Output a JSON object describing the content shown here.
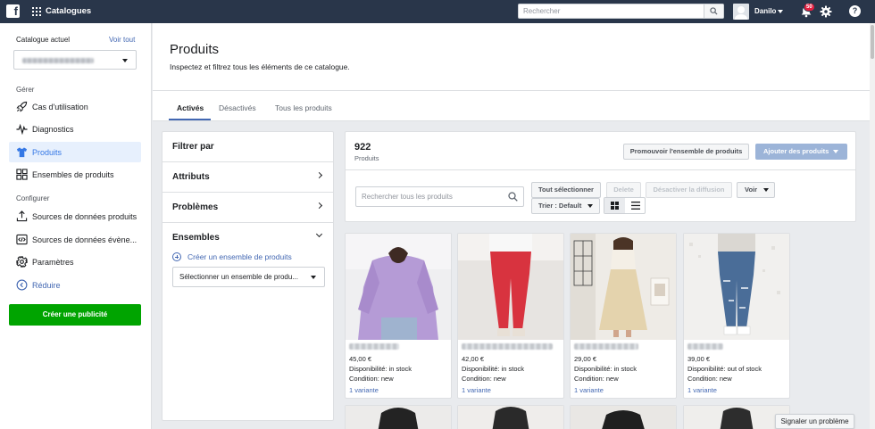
{
  "topbar": {
    "logo": "f",
    "app_name": "Catalogues",
    "search_placeholder": "Rechercher",
    "user_name": "Danilo",
    "notification_count": "50",
    "help": "?"
  },
  "sidebar": {
    "catalog_label": "Catalogue actuel",
    "see_all": "Voir tout",
    "manage_label": "Gérer",
    "configure_label": "Configurer",
    "manage_items": [
      {
        "label": "Cas d'utilisation",
        "icon": "rocket-icon"
      },
      {
        "label": "Diagnostics",
        "icon": "pulse-icon"
      },
      {
        "label": "Produits",
        "icon": "shirt-icon",
        "active": true
      },
      {
        "label": "Ensembles de produits",
        "icon": "grid-icon"
      }
    ],
    "configure_items": [
      {
        "label": "Sources de données produits",
        "icon": "upload-icon"
      },
      {
        "label": "Sources de données évène...",
        "icon": "code-icon"
      },
      {
        "label": "Paramètres",
        "icon": "gear-icon"
      }
    ],
    "reduce": "Réduire",
    "create_ad": "Créer une publicité"
  },
  "header": {
    "title": "Produits",
    "subtitle": "Inspectez et filtrez tous les éléments de ce catalogue.",
    "tabs": [
      "Activés",
      "Désactivés",
      "Tous les produits"
    ]
  },
  "filters": {
    "title": "Filtrer par",
    "attributes": "Attributs",
    "problems": "Problèmes",
    "sets": "Ensembles",
    "create_set": "Créer un ensemble de produits",
    "select_set": "Sélectionner un ensemble de produ..."
  },
  "toolbar": {
    "count": "922",
    "count_label": "Produits",
    "promote": "Promouvoir l'ensemble de produits",
    "add_products": "Ajouter des produits",
    "search_placeholder": "Rechercher tous les produits",
    "select_all": "Tout sélectionner",
    "delete": "Delete",
    "disable": "Désactiver la diffusion",
    "view": "Voir",
    "sort": "Trier : Default"
  },
  "products": [
    {
      "price": "45,00 €",
      "availability": "Disponibilité: in stock",
      "condition": "Condition: new",
      "variant": "1 variante",
      "color": "#b79ad8"
    },
    {
      "price": "42,00 €",
      "availability": "Disponibilité: in stock",
      "condition": "Condition: new",
      "variant": "1 variante",
      "color": "#d8343f"
    },
    {
      "price": "29,00 €",
      "availability": "Disponibilité: in stock",
      "condition": "Condition: new",
      "variant": "1 variante",
      "color": "#e6d8b5"
    },
    {
      "price": "39,00 €",
      "availability": "Disponibilité: out of stock",
      "condition": "Condition: new",
      "variant": "1 variante",
      "color": "#4d6f9a"
    }
  ],
  "report_problem": "Signaler un problème"
}
